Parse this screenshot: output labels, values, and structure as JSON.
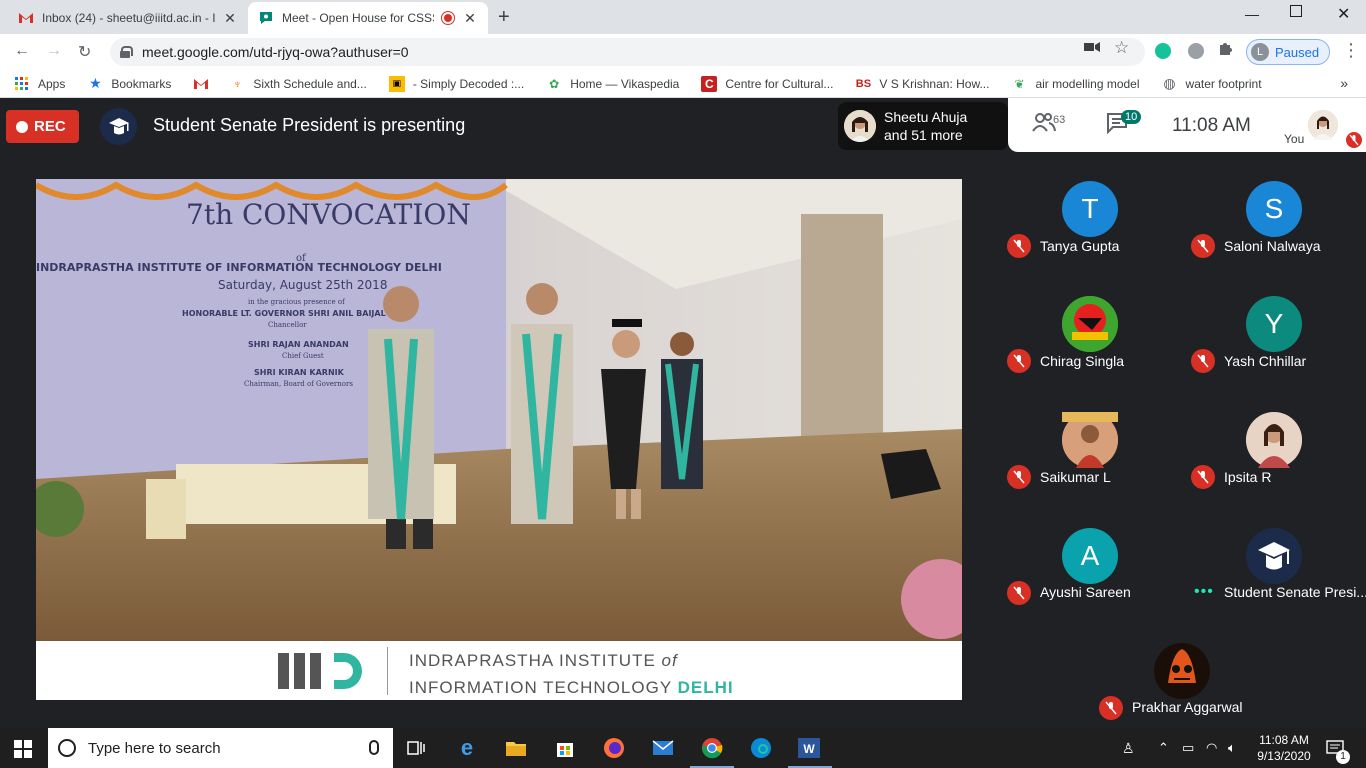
{
  "browser": {
    "tabs": [
      {
        "title": "Inbox (24) - sheetu@iiitd.ac.in - I"
      },
      {
        "title": "Meet - Open House for CSSS"
      }
    ],
    "url": "meet.google.com/utd-rjyq-owa?authuser=0",
    "profile_initial": "L",
    "profile_status": "Paused",
    "bookmarks": [
      {
        "label": "Apps",
        "icon": "apps-grid-icon"
      },
      {
        "label": "Bookmarks",
        "icon": "star-icon"
      },
      {
        "label": "",
        "icon": "gmail-icon"
      },
      {
        "label": "Sixth Schedule and...",
        "icon": "scale-icon"
      },
      {
        "label": "- Simply Decoded :...",
        "icon": "simply-decoded-icon"
      },
      {
        "label": "Home — Vikaspedia",
        "icon": "vikaspedia-icon"
      },
      {
        "label": "Centre for Cultural...",
        "icon": "ccrt-icon"
      },
      {
        "label": "V S Krishnan: How...",
        "icon": "bs-icon"
      },
      {
        "label": "air modelling model",
        "icon": "plant-icon"
      },
      {
        "label": "water footprint",
        "icon": "globe-icon"
      }
    ],
    "bookmark_bs_text": "BS"
  },
  "meet": {
    "rec_label": "REC",
    "presenting_text": "Student Senate President is presenting",
    "people_card": {
      "line1": "Sheetu Ahuja",
      "line2": "and 51 more"
    },
    "participants_count": "63",
    "chat_count": "10",
    "time": "11:08  AM",
    "you_label": "You",
    "presentation": {
      "banner_title_1": "7th CONVOCATION",
      "banner_title_2": "of",
      "banner_title_3": "INDRAPRASTHA INSTITUTE OF INFORMATION TECHNOLOGY DELHI",
      "banner_date": "Saturday, August 25th 2018",
      "banner_presence": "in the gracious presence of",
      "banner_guest1": "HONORABLE LT. GOVERNOR SHRI ANIL BAIJAL",
      "banner_guest1_role": "Chancellor",
      "banner_guest2": "SHRI RAJAN ANANDAN",
      "banner_guest2_role": "Chief Guest",
      "banner_guest3": "SHRI KIRAN KARNIK",
      "banner_guest3_role": "Chairman, Board of Governors",
      "footer_line1_a": "INDRAPRASTHA INSTITUTE ",
      "footer_line1_b": "of",
      "footer_line2_a": "INFORMATION TECHNOLOGY ",
      "footer_line2_b": "DELHI"
    },
    "participants": [
      {
        "name": "Tanya Gupta",
        "initial": "T",
        "color": "#1a86d6",
        "type": "initial",
        "muted": true
      },
      {
        "name": "Saloni Nalwaya",
        "initial": "S",
        "color": "#1a86d6",
        "type": "initial",
        "muted": true
      },
      {
        "name": "Chirag Singla",
        "initial": "",
        "color": "#3ea62e",
        "type": "photo",
        "muted": true
      },
      {
        "name": "Yash Chhillar",
        "initial": "Y",
        "color": "#0d8a7e",
        "type": "initial",
        "muted": true
      },
      {
        "name": "Saikumar L",
        "initial": "",
        "color": "#b98a6a",
        "type": "photo",
        "muted": true
      },
      {
        "name": "Ipsita R",
        "initial": "",
        "color": "#c7867a",
        "type": "photo",
        "muted": true
      },
      {
        "name": "Ayushi Sareen",
        "initial": "A",
        "color": "#0aa3ad",
        "type": "initial",
        "muted": true
      },
      {
        "name": "Student Senate Presi...",
        "initial": "",
        "color": "#1c2b4a",
        "type": "photo",
        "muted": false
      },
      {
        "name": "Prakhar Aggarwal",
        "initial": "",
        "color": "#3a1d12",
        "type": "photo",
        "muted": true
      }
    ]
  },
  "taskbar": {
    "search_placeholder": "Type here to search",
    "time": "11:08 AM",
    "date": "9/13/2020",
    "notification_count": "1"
  }
}
